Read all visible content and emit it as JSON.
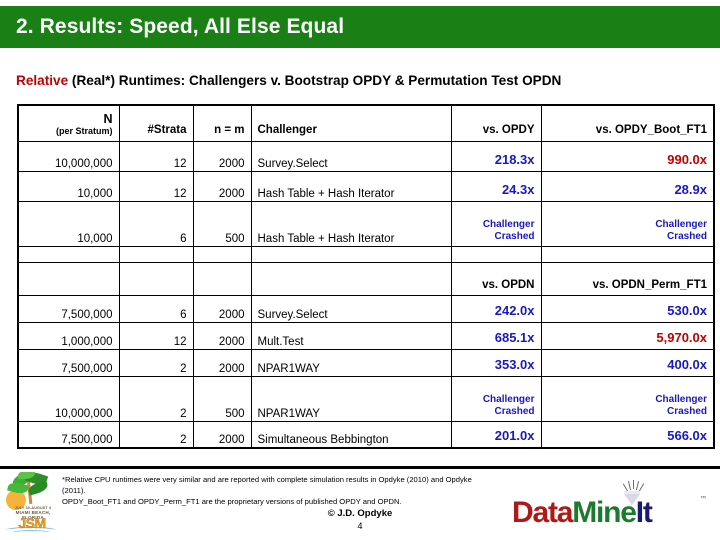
{
  "slide": {
    "title": "2. Results: Speed, All Else Equal",
    "subtitle": {
      "highlight": "Relative",
      "rest": " (Real*) Runtimes: Challengers v. Bootstrap OPDY & Permutation Test OPDN"
    },
    "banner_color": "#1a8015",
    "highlight_color": "#C00000"
  },
  "table": {
    "headers": {
      "n": "N",
      "n_sub": "(per Stratum)",
      "strata": "#Strata",
      "nm": "n = m",
      "challenger": "Challenger",
      "vs_opdy": "vs. OPDY",
      "vs_opdy_boot": "vs. OPDY_Boot_FT1",
      "vs_opdn": "vs. OPDN",
      "vs_opdn_perm": "vs. OPDN_Perm_FT1"
    },
    "section1_rows": [
      {
        "n": "10,000,000",
        "strata": "12",
        "nm": "2000",
        "challenger": "Survey.Select",
        "v1": "218.3x",
        "v1_color": "blue",
        "v2": "990.0x",
        "v2_color": "red",
        "crashed": false
      },
      {
        "n": "10,000",
        "strata": "12",
        "nm": "2000",
        "challenger": "Hash Table + Hash Iterator",
        "v1": "24.3x",
        "v1_color": "blue",
        "v2": "28.9x",
        "v2_color": "blue",
        "crashed": false
      },
      {
        "n": "10,000",
        "strata": "6",
        "nm": "500",
        "challenger": "Hash Table + Hash Iterator",
        "v1": "Challenger Crashed",
        "v1_color": "blue",
        "v2": "Challenger Crashed",
        "v2_color": "blue",
        "crashed": true
      }
    ],
    "section2_rows": [
      {
        "n": "7,500,000",
        "strata": "6",
        "nm": "2000",
        "challenger": "Survey.Select",
        "v1": "242.0x",
        "v1_color": "blue",
        "v2": "530.0x",
        "v2_color": "blue",
        "crashed": false
      },
      {
        "n": "1,000,000",
        "strata": "12",
        "nm": "2000",
        "challenger": "Mult.Test",
        "v1": "685.1x",
        "v1_color": "blue",
        "v2": "5,970.0x",
        "v2_color": "red",
        "crashed": false
      },
      {
        "n": "7,500,000",
        "strata": "2",
        "nm": "2000",
        "challenger": "NPAR1WAY",
        "v1": "353.0x",
        "v1_color": "blue",
        "v2": "400.0x",
        "v2_color": "blue",
        "crashed": false
      },
      {
        "n": "10,000,000",
        "strata": "2",
        "nm": "500",
        "challenger": "NPAR1WAY",
        "v1": "Challenger Crashed",
        "v1_color": "blue",
        "v2": "Challenger Crashed",
        "v2_color": "blue",
        "crashed": true
      },
      {
        "n": "7,500,000",
        "strata": "2",
        "nm": "2000",
        "challenger": "Simultaneous Bebbington",
        "v1": "201.0x",
        "v1_color": "blue",
        "v2": "566.0x",
        "v2_color": "blue",
        "crashed": false
      }
    ],
    "crashed_line1": "Challenger",
    "crashed_line2": "Crashed",
    "value_blue": "#1818C0",
    "value_red": "#C00000"
  },
  "footer": {
    "footnote_line1": "*Relative CPU runtimes were very similar and are reported with complete simulation results in Opdyke (2010) and Opdyke (2011).",
    "footnote_line2": "OPDY_Boot_FT1 and OPDY_Perm_FT1 are the proprietary versions of published OPDY and OPDN.",
    "copyright": "© J.D. Opdyke",
    "page_number": "4",
    "jsm_logo": {
      "line1": "JULY 30-AUGUST 4",
      "line2": "MIAMI BEACH, FLORIDA",
      "big": "JSM 2011"
    },
    "datamineit_logo": {
      "part1": "D",
      "part2": "ata",
      "part3": "M",
      "part4": "ine",
      "part5": "It",
      "tm": "™"
    }
  }
}
